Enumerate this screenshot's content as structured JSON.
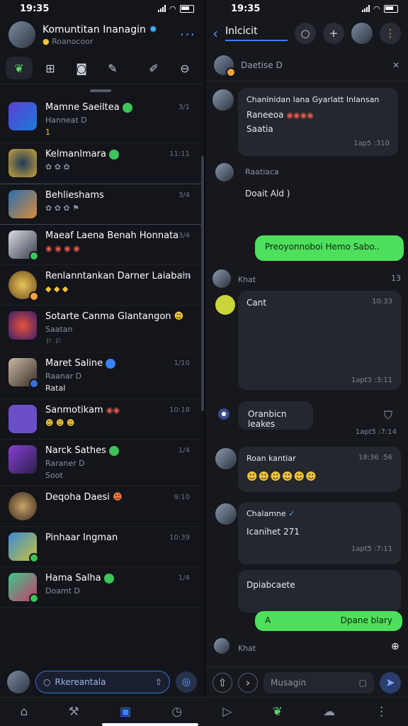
{
  "status_left": {
    "time": "19:35"
  },
  "status_right": {
    "time": "19:35"
  },
  "left_header": {
    "title": "Komuntitan Inanagin",
    "subtitle": "Roanocoor"
  },
  "chat_list": [
    {
      "name": "Mamne Saeiltea",
      "sub": "Hanneat D",
      "extra": "1",
      "time": "3/1"
    },
    {
      "name": "Kelmanlmara",
      "sub": "",
      "extra": "",
      "time": "11:11"
    },
    {
      "name": "Behlieshams",
      "sub": "",
      "extra": "",
      "time": "3/4"
    },
    {
      "name": "Maeaf Laena Benah Honnata",
      "sub": "",
      "extra": "",
      "time": "3/4"
    },
    {
      "name": "Renlanntankan Darner Laiabain",
      "sub": "",
      "extra": "",
      "time": "3/4"
    },
    {
      "name": "Sotarte Canma Glantangon",
      "sub": "Saatan",
      "extra": "",
      "time": ""
    },
    {
      "name": "Maret Saline",
      "sub": "Raanar D",
      "extra": "Ratal",
      "time": "1/10"
    },
    {
      "name": "Sanmotikam",
      "sub": "",
      "extra": "",
      "time": "10:18"
    },
    {
      "name": "Narck Sathes",
      "sub": "Raraner D",
      "extra": "Soot",
      "time": "1/4"
    },
    {
      "name": "Deqoha Daesi",
      "sub": "",
      "extra": "",
      "time": "9:10"
    },
    {
      "name": "Pinhaar Ingman",
      "sub": "",
      "extra": "",
      "time": "10:39"
    },
    {
      "name": "Hama Salha",
      "sub": "Doamt D",
      "extra": "",
      "time": "1/4"
    }
  ],
  "left_compose": {
    "placeholder": "Rkereantala"
  },
  "right_header": {
    "title": "Inlcicit"
  },
  "right_sub": {
    "label": "Daetise D"
  },
  "messages": {
    "m1": {
      "title": "Chanlnidan lana Gyarlatt Inlansan",
      "line2": "Raneeoa",
      "line3": "Saatia",
      "time": "1ap5 :310"
    },
    "m2": {
      "sender": "Raatiaca",
      "text": "Doait Ald )"
    },
    "m3": {
      "text": "Preoyonnoboi Hemo Sabo.."
    },
    "m4": {
      "sender": "Khat",
      "time_top": "13",
      "text": "Cant",
      "time": "1apt3 :3:11",
      "time2": "10:33"
    },
    "m5": {
      "text": "Oranbicn leakes",
      "time": "1apt5 :7:14"
    },
    "m6": {
      "sender": "Roan kantiar",
      "time": "18:36 :56"
    },
    "m7": {
      "sender": "Chalamne",
      "text": "Icanihet 271",
      "time": "1apt5 :7:11"
    },
    "m8": {
      "text": "Dpiabcaete"
    },
    "m9": {
      "prefix": "A",
      "text": "Dpane blary"
    },
    "m10": {
      "sender": "Khat"
    }
  },
  "right_compose": {
    "placeholder": "Musagin"
  }
}
